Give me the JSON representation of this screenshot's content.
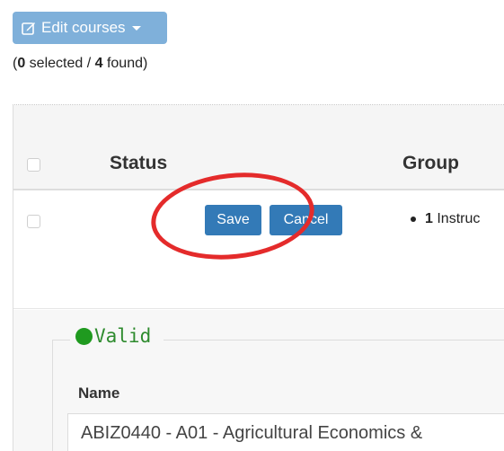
{
  "toolbar": {
    "edit_courses_label": "Edit courses"
  },
  "selection": {
    "open_paren": "(",
    "selected_count": "0",
    "selected_text": " selected / ",
    "found_count": "4",
    "found_text": " found)"
  },
  "table": {
    "columns": [
      {
        "label": "Status"
      },
      {
        "label": "Group"
      }
    ],
    "row": {
      "save_label": "Save",
      "cancel_label": "Cancel",
      "group_count": "1",
      "group_text": "Instruc"
    }
  },
  "detail": {
    "status_label": "Valid",
    "name_label": "Name",
    "name_value": "ABIZ0440 - A01 - Agricultural Economics &"
  },
  "colors": {
    "primary": "#337ab7",
    "edit_button": "#7fb0da",
    "valid_green": "#1f9a1f",
    "annotation_red": "#e42b2b"
  },
  "icons": {
    "edit": "edit-icon",
    "caret": "caret-down-icon",
    "status": "status-dot-icon"
  }
}
